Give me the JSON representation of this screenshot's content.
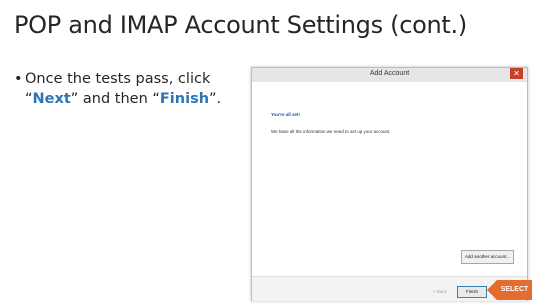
{
  "slide": {
    "title": "POP and IMAP Account Settings (cont.)",
    "bullet": {
      "marker": "•",
      "before": "Once the tests pass, click “",
      "next": "Next",
      "middle": "” and then “",
      "finish": "Finish",
      "after": "”."
    }
  },
  "dialog": {
    "title": "Add Account",
    "close": "✕",
    "heading": "You're all set!",
    "message": "We have all the information we need to set up your account.",
    "add_another": "Add another account...",
    "back": "< Back",
    "finish": "Finish"
  },
  "callout": {
    "label": "SELECT",
    "color": "#e46c2f"
  },
  "colors": {
    "highlight": "#2e75b6",
    "close_button": "#c7402b"
  }
}
